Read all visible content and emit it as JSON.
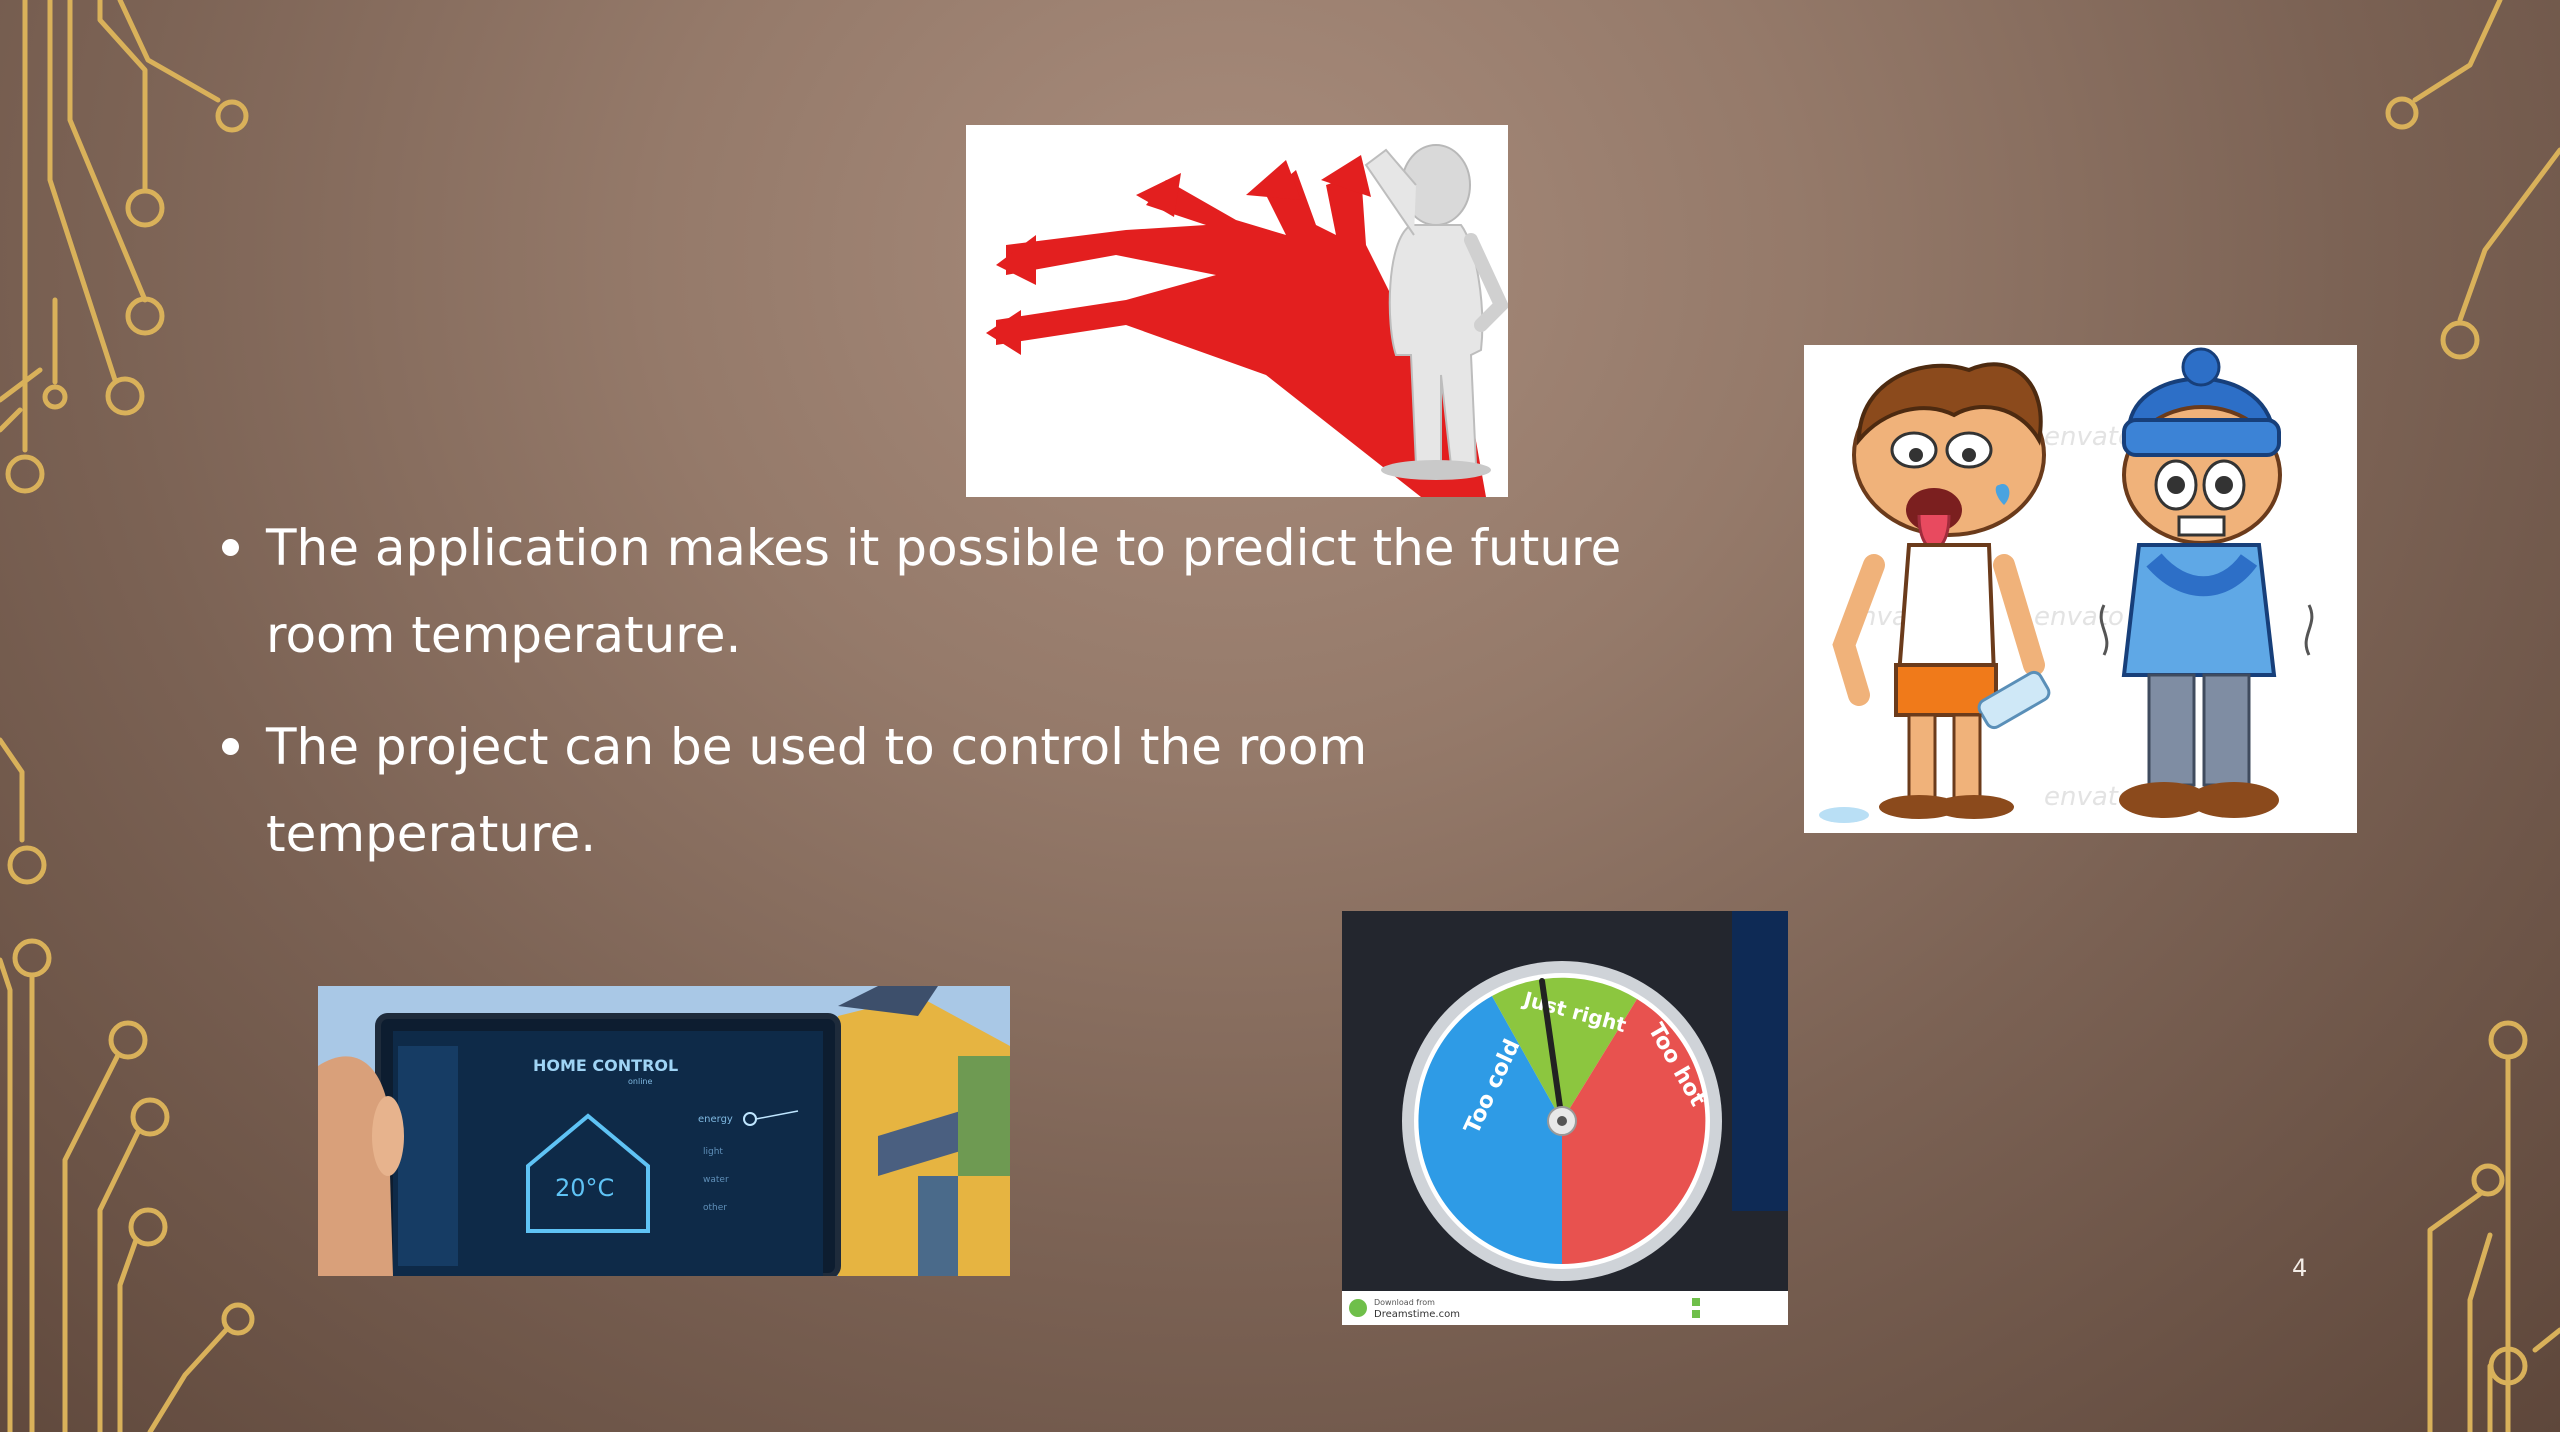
{
  "slide": {
    "bullets": [
      "The application makes it possible to predict the future room temperature.",
      "The project can be used to control the room temperature."
    ],
    "page_number": "4"
  },
  "images": {
    "decision": {
      "icon": "decision-arrows-figure"
    },
    "hot_cold_kids": {
      "icon": "hot-and-cold-cartoon",
      "watermark": "envato"
    },
    "home_control": {
      "icon": "home-control-tablet",
      "header": "HOME CONTROL",
      "sub": "online",
      "temp": "20°C",
      "menu": [
        "energy",
        "light",
        "water",
        "other"
      ]
    },
    "gauge": {
      "icon": "temperature-gauge",
      "labels": {
        "cold": "Too cold",
        "right": "Just right",
        "hot": "Too hot"
      },
      "footer": "Download from",
      "footer_site": "Dreamstime.com",
      "watermark": "dreamstime"
    }
  },
  "colors": {
    "accent_gold": "#d9b15a",
    "bullet_text": "#ffffff"
  }
}
